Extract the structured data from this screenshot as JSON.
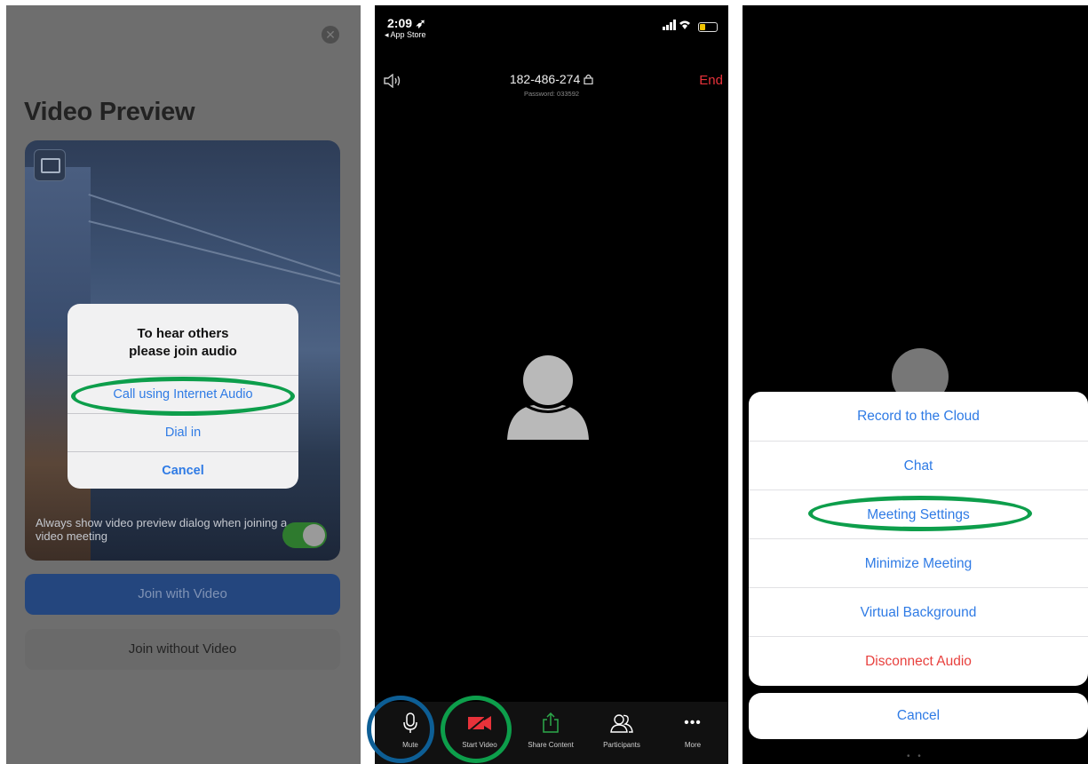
{
  "preview": {
    "title": "Video Preview",
    "close_label": "✕",
    "dialog": {
      "title_line1": "To hear others",
      "title_line2": "please join audio",
      "option_internet": "Call using Internet Audio",
      "option_dialin": "Dial in",
      "option_cancel": "Cancel"
    },
    "always_show_text": "Always show video preview dialog when joining a video meeting",
    "toggle_on": true,
    "join_with_video": "Join with Video",
    "join_without_video": "Join without Video"
  },
  "meeting": {
    "status": {
      "time": "2:09 ➶",
      "back_label": "◂ App Store"
    },
    "meeting_id": "182-486-274",
    "password_text": "Password: 033592",
    "end_label": "End",
    "toolbar": [
      {
        "label": "Mute",
        "icon": "microphone-icon"
      },
      {
        "label": "Start Video",
        "icon": "video-off-icon"
      },
      {
        "label": "Share Content",
        "icon": "share-icon"
      },
      {
        "label": "Participants",
        "icon": "participants-icon"
      },
      {
        "label": "More",
        "icon": "more-icon"
      }
    ]
  },
  "more_menu": {
    "items": [
      {
        "label": "Record to the Cloud",
        "style": "default"
      },
      {
        "label": "Chat",
        "style": "default"
      },
      {
        "label": "Meeting Settings",
        "style": "default"
      },
      {
        "label": "Minimize Meeting",
        "style": "default"
      },
      {
        "label": "Virtual Background",
        "style": "default"
      },
      {
        "label": "Disconnect Audio",
        "style": "destructive"
      }
    ],
    "cancel_label": "Cancel"
  },
  "colors": {
    "accent_blue": "#2f7be5",
    "highlight_green": "#0d9e4b",
    "highlight_blue": "#0d5e95",
    "end_red": "#e8323a",
    "video_off_red": "#e8323a"
  }
}
